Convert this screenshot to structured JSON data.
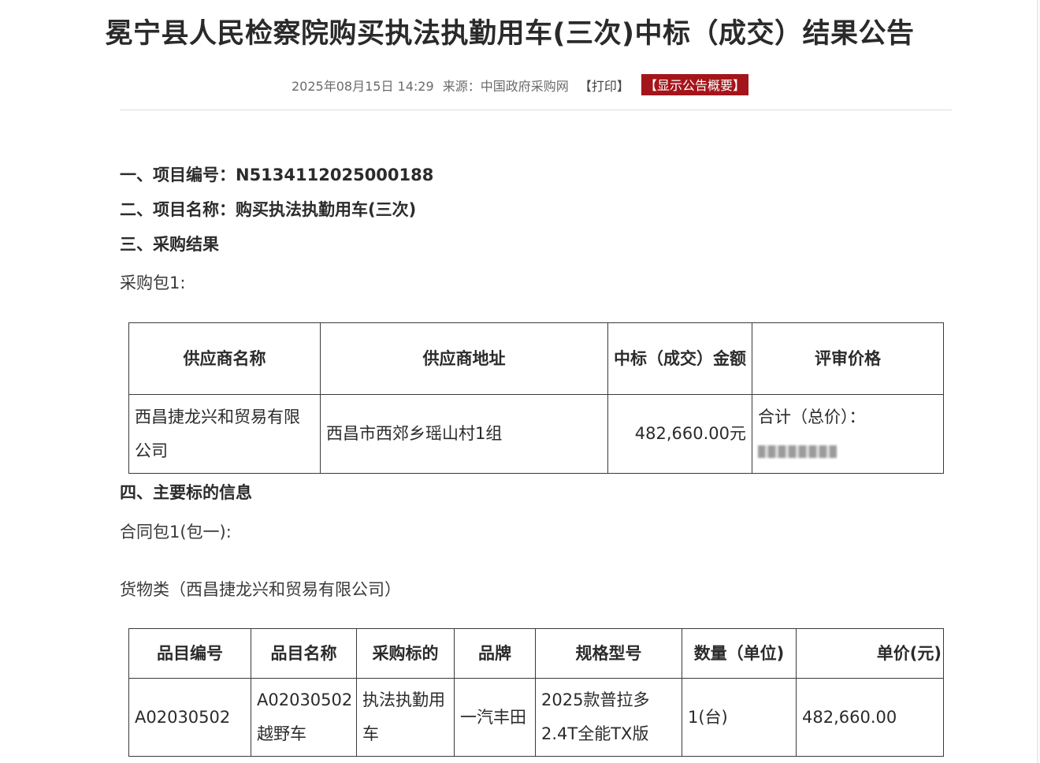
{
  "title": "冕宁县人民检察院购买执法执勤用车(三次)中标（成交）结果公告",
  "meta": {
    "datetime": "2025年08月15日 14:29",
    "source_label": "来源：",
    "source": "中国政府采购网",
    "print_label": "【打印】",
    "summary_button": "【显示公告概要】",
    "summary_color": "#a4151b"
  },
  "sections": {
    "project_number": "一、项目编号：N5134112025000188",
    "project_name": "二、项目名称：购买执法执勤用车(三次)",
    "procurement_result": "三、采购结果",
    "package_label": "采购包1:",
    "main_info": "四、主要标的信息",
    "contract_package": "合同包1(包一):",
    "goods_label": "货物类（西昌捷龙兴和贸易有限公司）"
  },
  "result_table": {
    "headers": [
      "供应商名称",
      "供应商地址",
      "中标（成交）金额",
      "评审价格"
    ],
    "rows": [
      {
        "supplier_name": "西昌捷龙兴和贸易有限公司",
        "supplier_address": "西昌市西郊乡瑶山村1组",
        "amount": "482,660.00元",
        "review_price_label": "合计（总价）："
      }
    ]
  },
  "items_table": {
    "headers": [
      "品目编号",
      "品目名称",
      "采购标的",
      "品牌",
      "规格型号",
      "数量（单位)",
      "单价(元)"
    ],
    "rows": [
      {
        "item_code": "A02030502",
        "item_name": "A02030502越野车",
        "subject": "执法执勤用车",
        "brand": "一汽丰田",
        "model": "2025款普拉多2.4T全能TX版",
        "quantity": "1(台)",
        "unit_price": "482,660.00"
      }
    ]
  }
}
